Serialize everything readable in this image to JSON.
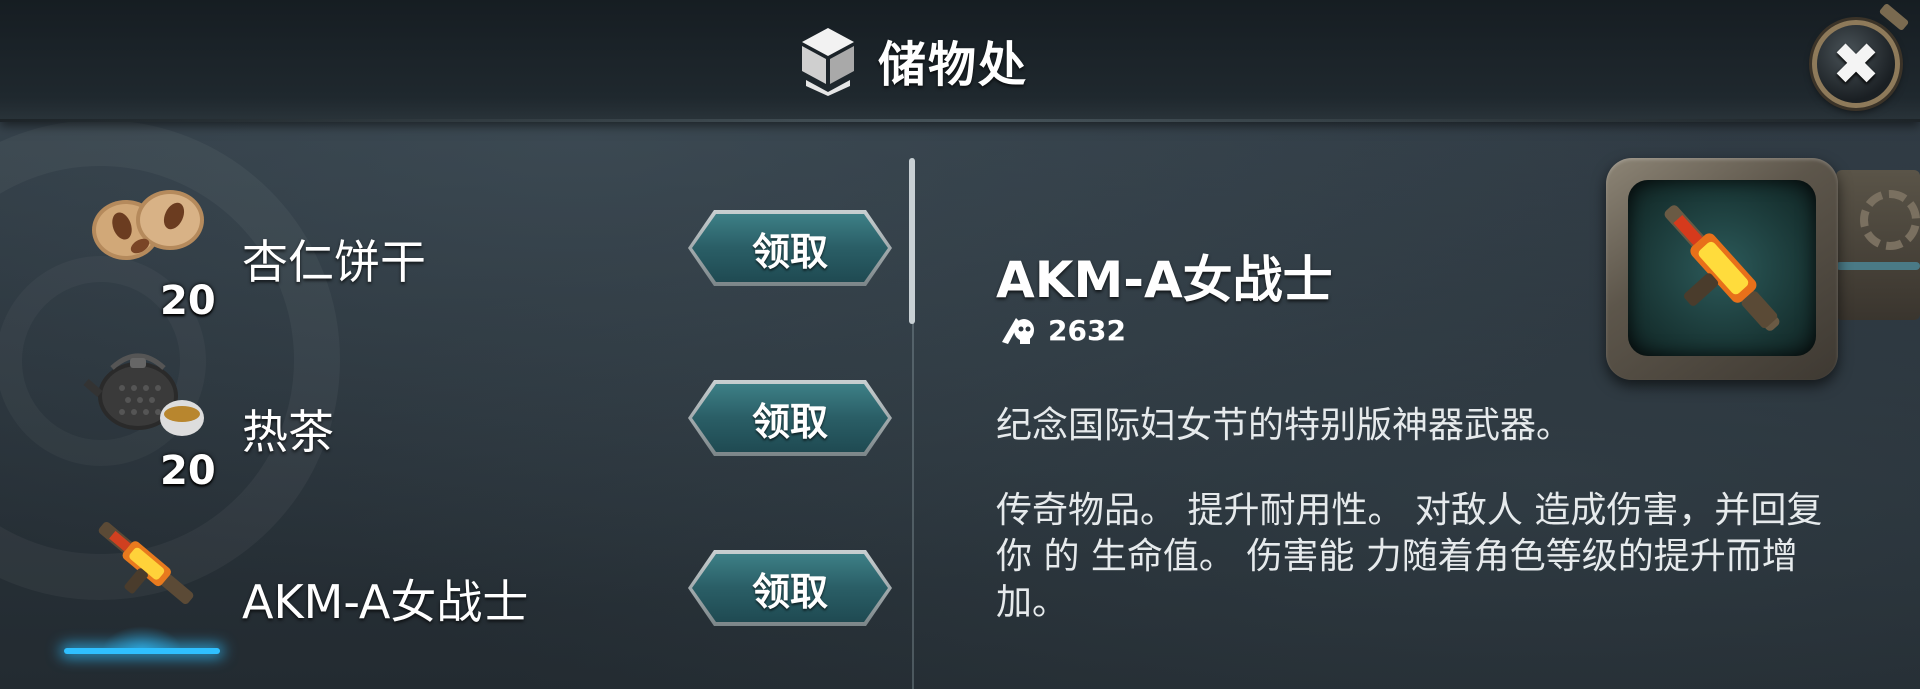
{
  "header": {
    "title": "储物处",
    "storage_icon": "storage-box-icon",
    "close_icon": "close-icon",
    "close_symbol": "✖"
  },
  "items": [
    {
      "name": "杏仁饼干",
      "count": "20",
      "icon": "almond-cookies-icon",
      "claim_label": "领取"
    },
    {
      "name": "热茶",
      "count": "20",
      "icon": "teapot-icon",
      "claim_label": "领取"
    },
    {
      "name": "AKM-A女战士",
      "count": "",
      "icon": "rifle-icon",
      "claim_label": "领取",
      "selected": true
    }
  ],
  "detail": {
    "name": "AKM-A女战士",
    "power_icon": "skull-icon",
    "power_value": "2632",
    "description_line1": "纪念国际妇女节的特别版神器武器。",
    "description_line2": "传奇物品。 提升耐用性。 对敌人 造成伤害，并回复你 的 生命值。 伤害能 力随着角色等级的提升而增加。",
    "preview_icon": "rifle-preview-icon"
  },
  "colors": {
    "button": "#2a5e66",
    "accent_glow": "#2fc0ff",
    "frame": "#8d8576"
  }
}
